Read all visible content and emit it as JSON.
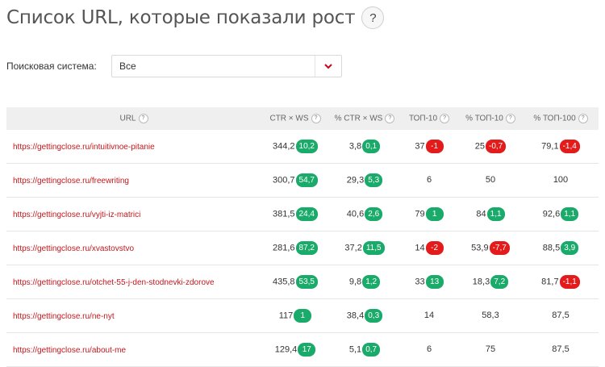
{
  "page": {
    "title": "Список URL, которые показали рост",
    "help": "?"
  },
  "filter": {
    "label": "Поисковая система:",
    "value": "Все"
  },
  "table": {
    "headers": [
      "URL",
      "CTR × WS",
      "% CTR × WS",
      "ТОП-10",
      "% ТОП-10",
      "% ТОП-100"
    ],
    "rows": [
      {
        "url": "https://gettingclose.ru/intuitivnoe-pitanie",
        "cells": [
          {
            "v": "344,2",
            "b": "10,2",
            "d": "up"
          },
          {
            "v": "3,8",
            "b": "0,1",
            "d": "up"
          },
          {
            "v": "37",
            "b": "-1",
            "d": "down"
          },
          {
            "v": "25",
            "b": "-0,7",
            "d": "down"
          },
          {
            "v": "79,1",
            "b": "-1,4",
            "d": "down"
          }
        ]
      },
      {
        "url": "https://gettingclose.ru/freewriting",
        "cells": [
          {
            "v": "300,7",
            "b": "54,7",
            "d": "up"
          },
          {
            "v": "29,3",
            "b": "5,3",
            "d": "up"
          },
          {
            "v": "6"
          },
          {
            "v": "50"
          },
          {
            "v": "100"
          }
        ]
      },
      {
        "url": "https://gettingclose.ru/vyjti-iz-matrici",
        "cells": [
          {
            "v": "381,5",
            "b": "24,4",
            "d": "up"
          },
          {
            "v": "40,6",
            "b": "2,6",
            "d": "up"
          },
          {
            "v": "79",
            "b": "1",
            "d": "up"
          },
          {
            "v": "84",
            "b": "1,1",
            "d": "up"
          },
          {
            "v": "92,6",
            "b": "1,1",
            "d": "up"
          }
        ]
      },
      {
        "url": "https://gettingclose.ru/xvastovstvo",
        "cells": [
          {
            "v": "281,6",
            "b": "87,2",
            "d": "up"
          },
          {
            "v": "37,2",
            "b": "11,5",
            "d": "up"
          },
          {
            "v": "14",
            "b": "-2",
            "d": "down"
          },
          {
            "v": "53,9",
            "b": "-7,7",
            "d": "down"
          },
          {
            "v": "88,5",
            "b": "3,9",
            "d": "up"
          }
        ]
      },
      {
        "url": "https://gettingclose.ru/otchet-55-j-den-stodnevki-zdorove",
        "cells": [
          {
            "v": "435,8",
            "b": "53,5",
            "d": "up"
          },
          {
            "v": "9,8",
            "b": "1,2",
            "d": "up"
          },
          {
            "v": "33",
            "b": "13",
            "d": "up"
          },
          {
            "v": "18,3",
            "b": "7,2",
            "d": "up"
          },
          {
            "v": "81,7",
            "b": "-1,1",
            "d": "down"
          }
        ]
      },
      {
        "url": "https://gettingclose.ru/ne-nyt",
        "cells": [
          {
            "v": "117",
            "b": "1",
            "d": "up"
          },
          {
            "v": "38,4",
            "b": "0,3",
            "d": "up"
          },
          {
            "v": "14"
          },
          {
            "v": "58,3"
          },
          {
            "v": "87,5"
          }
        ]
      },
      {
        "url": "https://gettingclose.ru/about-me",
        "cells": [
          {
            "v": "129,4",
            "b": "17",
            "d": "up"
          },
          {
            "v": "5,1",
            "b": "0,7",
            "d": "up"
          },
          {
            "v": "6"
          },
          {
            "v": "75"
          },
          {
            "v": "87,5"
          }
        ]
      }
    ]
  },
  "colors": {
    "up": "#1aaa6a",
    "down": "#e31b1b",
    "link": "#c4161c",
    "header_bg": "#efefef"
  },
  "icons": {
    "help": "question-circle-icon",
    "dropdown": "chevron-down-icon"
  }
}
